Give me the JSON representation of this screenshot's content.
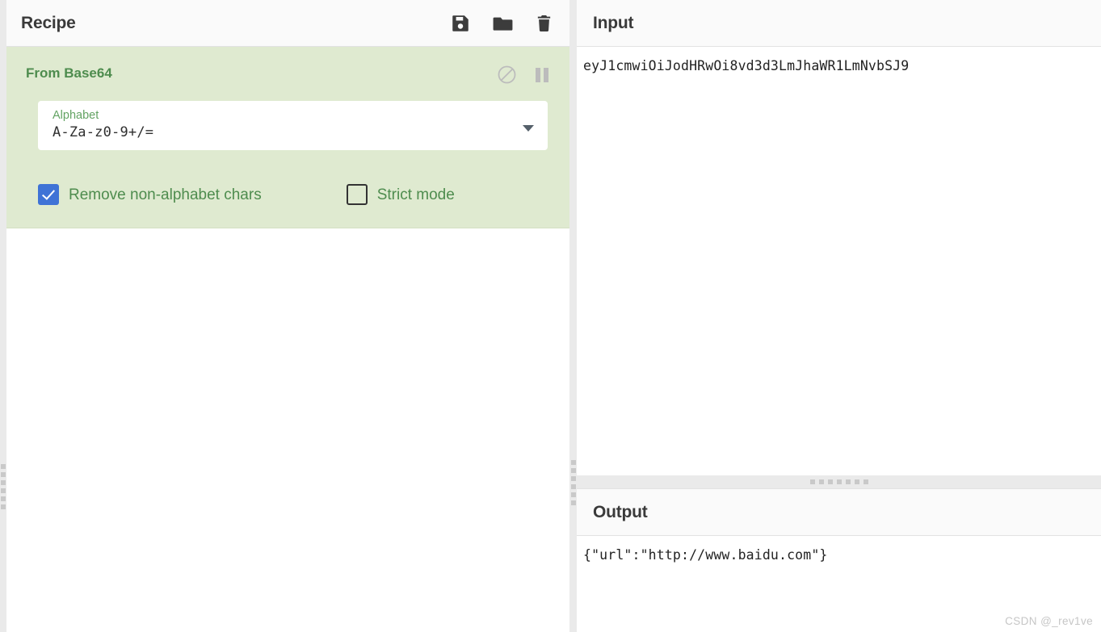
{
  "recipe": {
    "title": "Recipe",
    "actions": [
      {
        "name": "save-recipe",
        "icon": "floppy-disk-icon",
        "label": "Save recipe"
      },
      {
        "name": "load-recipe",
        "icon": "folder-icon",
        "label": "Load recipe"
      },
      {
        "name": "clear-recipe",
        "icon": "trash-icon",
        "label": "Clear recipe"
      }
    ],
    "operations": [
      {
        "title": "From Base64",
        "disable_icon": "circle-slash-icon",
        "pause_icon": "pause-icon",
        "ingredient": {
          "label": "Alphabet",
          "value": "A-Za-z0-9+/=",
          "dropdown_icon": "chevron-down-icon"
        },
        "checkboxes": [
          {
            "label": "Remove non-alphabet chars",
            "checked": true
          },
          {
            "label": "Strict mode",
            "checked": false
          }
        ]
      }
    ]
  },
  "input": {
    "title": "Input",
    "value": "eyJ1cmwiOiJodHRwOi8vd3d3LmJhaWR1LmNvbSJ9"
  },
  "output": {
    "title": "Output",
    "value": "{\"url\":\"http://www.baidu.com\"}"
  },
  "watermark": "CSDN @_rev1ve",
  "colors": {
    "operation_bg": "#dfead0",
    "operation_title": "#4e8c4e",
    "checkbox_checked": "#3f73d6",
    "header_bg": "#fafafa",
    "gutter": "#eaeaea"
  }
}
